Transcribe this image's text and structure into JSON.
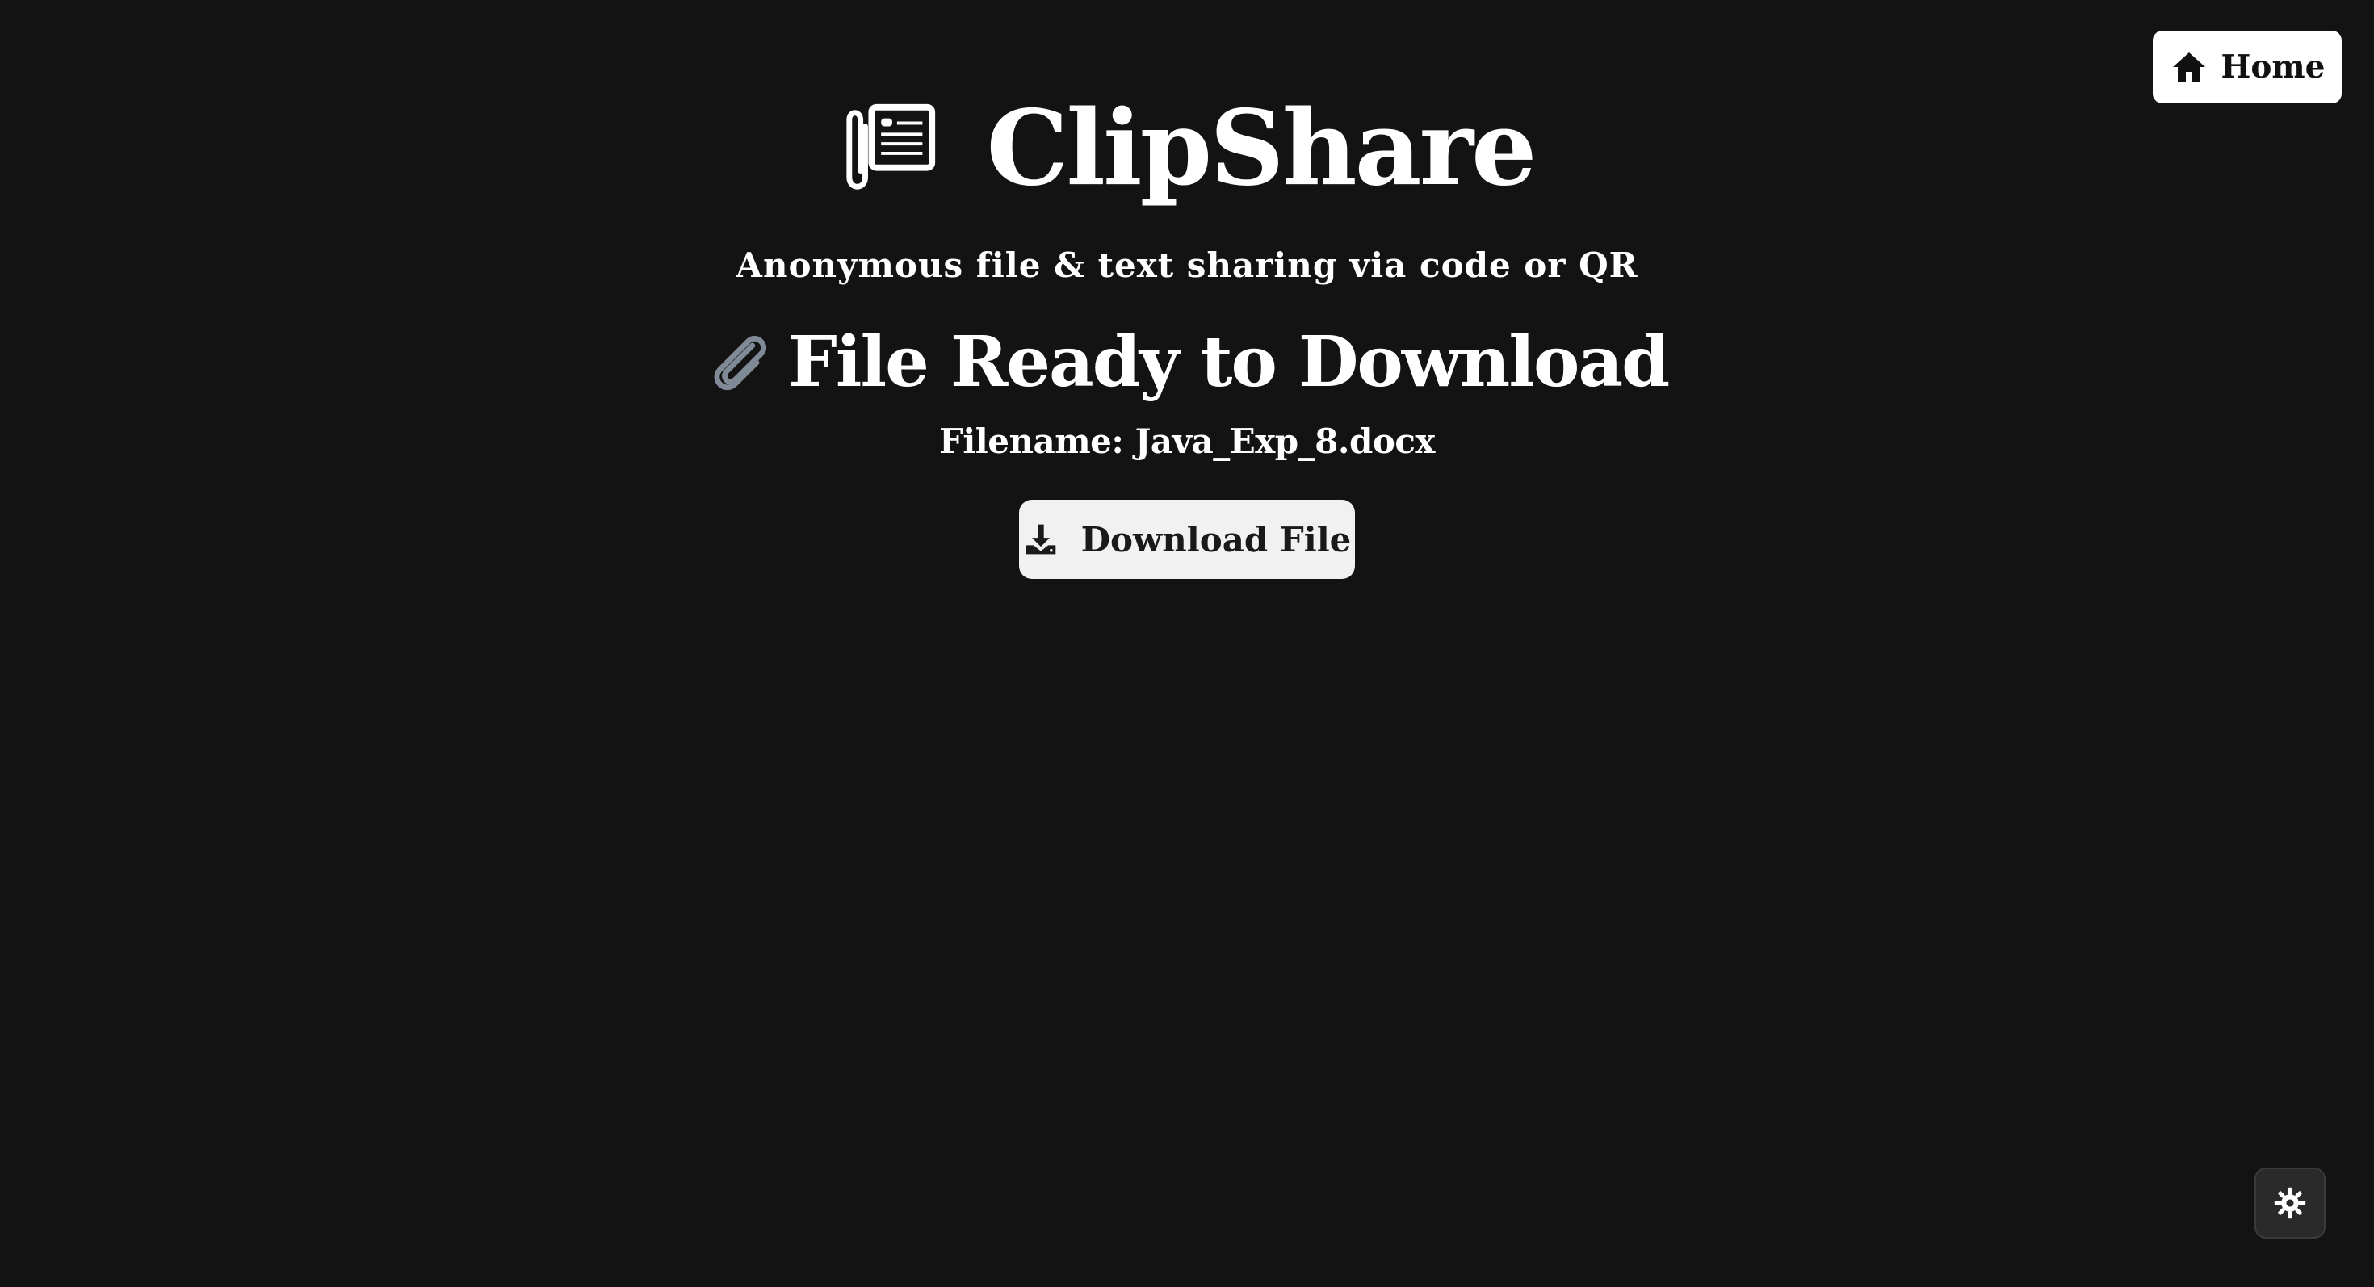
{
  "nav": {
    "home_label": "Home",
    "home_icon": "home-icon"
  },
  "header": {
    "logo_icon": "clipboard-paperclip-icon",
    "title": "ClipShare",
    "tagline": "Anonymous file & text sharing via code or QR"
  },
  "download": {
    "heading_icon": "paperclip-icon",
    "heading": "File Ready to Download",
    "filename_line": "Filename: Java_Exp_8.docx",
    "button_label": "Download File",
    "button_icon": "download-icon"
  },
  "theme_toggle": {
    "icon": "sun-gear-icon"
  },
  "colors": {
    "background": "#131313",
    "text": "#ffffff",
    "button_bg": "#f1f1f1",
    "toggle_bg": "#2a2a2a"
  }
}
